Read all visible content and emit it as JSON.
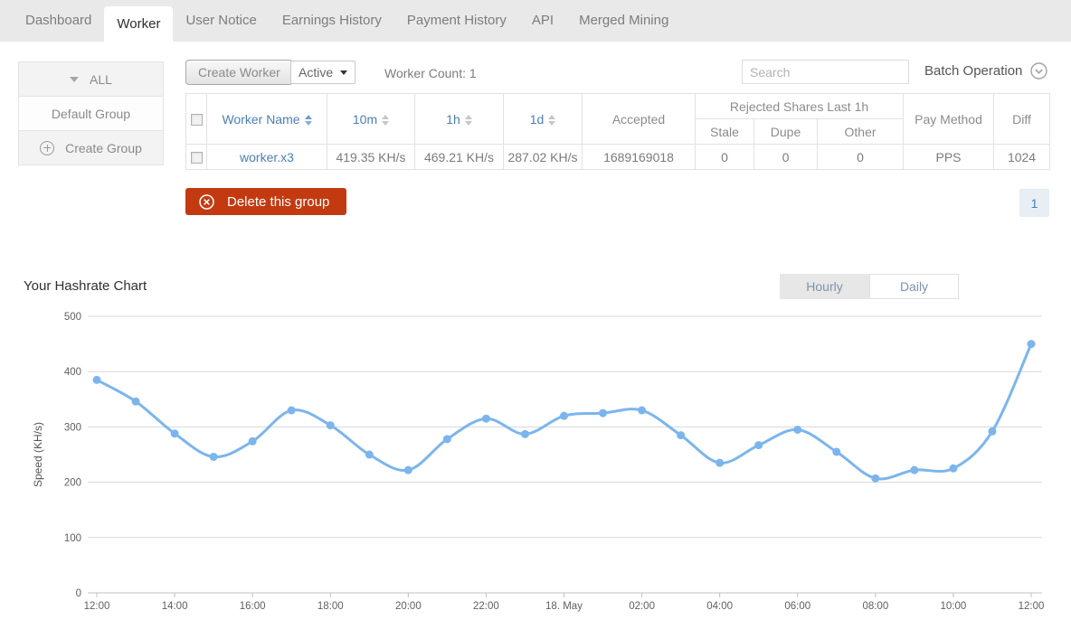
{
  "nav": {
    "tabs": [
      {
        "label": "Dashboard"
      },
      {
        "label": "Worker"
      },
      {
        "label": "User Notice"
      },
      {
        "label": "Earnings History"
      },
      {
        "label": "Payment History"
      },
      {
        "label": "API"
      },
      {
        "label": "Merged Mining"
      }
    ]
  },
  "sidebar": {
    "all_label": "ALL",
    "groups": [
      {
        "label": "Default Group"
      }
    ],
    "create_group_label": "Create Group"
  },
  "toolbar": {
    "create_worker_label": "Create Worker",
    "status_filter_value": "Active",
    "worker_count_label": "Worker Count: 1",
    "search_placeholder": "Search",
    "batch_operation_label": "Batch Operation"
  },
  "table": {
    "headers": {
      "worker_name": "Worker Name",
      "col_10m": "10m",
      "col_1h": "1h",
      "col_1d": "1d",
      "accepted": "Accepted",
      "rejected_group": "Rejected Shares Last 1h",
      "stale": "Stale",
      "dupe": "Dupe",
      "other": "Other",
      "pay_method": "Pay Method",
      "diff": "Diff"
    },
    "rows": [
      {
        "worker_name": "worker.x3",
        "speed_10m": "419.35 KH/s",
        "speed_1h": "469.21 KH/s",
        "speed_1d": "287.02 KH/s",
        "accepted": "1689169018",
        "stale": "0",
        "dupe": "0",
        "other": "0",
        "pay_method": "PPS",
        "diff": "1024"
      }
    ]
  },
  "actions": {
    "delete_group_label": "Delete this group"
  },
  "pagination": {
    "current_page": "1"
  },
  "chart_section": {
    "title": "Your Hashrate Chart",
    "toggle_hourly": "Hourly",
    "toggle_daily": "Daily"
  },
  "chart_data": {
    "type": "line",
    "title": "Your Hashrate Chart",
    "xlabel": "",
    "ylabel": "Speed (KH/s)",
    "ylim": [
      0,
      500
    ],
    "y_ticks": [
      0,
      100,
      200,
      300,
      400,
      500
    ],
    "grid": true,
    "legend": "none",
    "x": [
      "12:00",
      "13:00",
      "14:00",
      "15:00",
      "16:00",
      "17:00",
      "18:00",
      "19:00",
      "20:00",
      "21:00",
      "22:00",
      "23:00",
      "18. May",
      "01:00",
      "02:00",
      "03:00",
      "04:00",
      "05:00",
      "06:00",
      "07:00",
      "08:00",
      "09:00",
      "10:00",
      "11:00",
      "12:00"
    ],
    "x_tick_labels": [
      "12:00",
      "14:00",
      "16:00",
      "18:00",
      "20:00",
      "22:00",
      "18. May",
      "02:00",
      "04:00",
      "06:00",
      "08:00",
      "10:00",
      "12:00"
    ],
    "series": [
      {
        "name": "Speed",
        "color": "#7cb5ec",
        "values": [
          385,
          346,
          288,
          246,
          274,
          330,
          303,
          250,
          222,
          278,
          315,
          287,
          320,
          325,
          330,
          285,
          235,
          267,
          295,
          255,
          207,
          222,
          225,
          292,
          450
        ]
      }
    ]
  },
  "colors": {
    "accent_blue": "#4a80b5",
    "line_blue": "#7cb5ec",
    "danger_red": "#c43a10",
    "nav_bg": "#e9e9ea",
    "grid_line": "#d8d8d8",
    "axis_line": "#c0c0c0",
    "axis_text": "#606060"
  }
}
